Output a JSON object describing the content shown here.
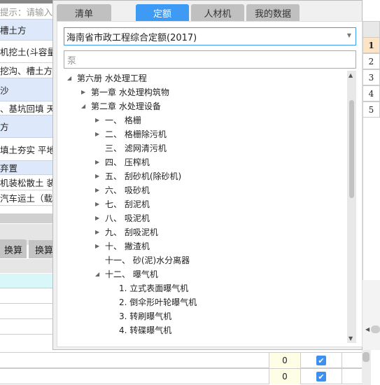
{
  "left_panel": {
    "hint": "提示：请输入子",
    "rows": [
      {
        "text": "槽土方",
        "highlight": true
      },
      {
        "text": "机挖土(斗容量(",
        "highlight": false
      },
      {
        "text": "挖沟、槽土方 -",
        "highlight": false
      },
      {
        "text": "沙",
        "highlight": true
      },
      {
        "text": "、基坑回填 天:",
        "highlight": false
      },
      {
        "text": "方",
        "highlight": true
      },
      {
        "text": "填土夯实 平地",
        "highlight": false
      },
      {
        "text": "弃置",
        "highlight": true
      },
      {
        "text": "机装松散土 装:",
        "highlight": false
      },
      {
        "text": "汽车运土（载重",
        "highlight": false
      }
    ],
    "tabs": [
      "换算",
      "换算"
    ]
  },
  "popup": {
    "tabs": [
      {
        "label": "清单",
        "active": false
      },
      {
        "label": "定额",
        "active": true
      },
      {
        "label": "人材机",
        "active": false
      },
      {
        "label": "我的数据",
        "active": false
      }
    ],
    "quota_select": {
      "value": "海南省市政工程综合定额(2017)"
    },
    "search": {
      "value": "泵"
    },
    "tree": [
      {
        "label": "第六册 水处理工程",
        "level": 0,
        "state": "expanded"
      },
      {
        "label": "第一章 水处理构筑物",
        "level": 1,
        "state": "collapsed"
      },
      {
        "label": "第二章 水处理设备",
        "level": 1,
        "state": "expanded"
      },
      {
        "label": "一、 格栅",
        "level": 2,
        "state": "collapsed"
      },
      {
        "label": "二、 格栅除污机",
        "level": 2,
        "state": "collapsed"
      },
      {
        "label": "三、 滤网清污机",
        "level": 2,
        "state": "leaf"
      },
      {
        "label": "四、 压榨机",
        "level": 2,
        "state": "collapsed"
      },
      {
        "label": "五、 刮砂机(除砂机)",
        "level": 2,
        "state": "collapsed"
      },
      {
        "label": "六、 吸砂机",
        "level": 2,
        "state": "collapsed"
      },
      {
        "label": "七、 刮泥机",
        "level": 2,
        "state": "collapsed"
      },
      {
        "label": "八、 吸泥机",
        "level": 2,
        "state": "collapsed"
      },
      {
        "label": "九、 刮吸泥机",
        "level": 2,
        "state": "collapsed"
      },
      {
        "label": "十、 撇渣机",
        "level": 2,
        "state": "collapsed"
      },
      {
        "label": "十一、 砂(泥)水分离器",
        "level": 2,
        "state": "leaf"
      },
      {
        "label": "十二、 曝气机",
        "level": 2,
        "state": "expanded"
      },
      {
        "label": "1. 立式表面曝气机",
        "level": 3,
        "state": "leaf"
      },
      {
        "label": "2. 倒伞形叶轮曝气机",
        "level": 3,
        "state": "leaf"
      },
      {
        "label": "3. 转刷曝气机",
        "level": 3,
        "state": "leaf"
      },
      {
        "label": "4. 转碟曝气机",
        "level": 3,
        "state": "leaf"
      }
    ]
  },
  "right_grid": {
    "row_numbers": [
      "1",
      "2",
      "3",
      "4",
      "5"
    ]
  },
  "bottom_rows": [
    {
      "value": "0",
      "checked": true
    },
    {
      "value": "0",
      "checked": true
    }
  ],
  "colors": {
    "accent": "#3d9bf5",
    "row_highlight": "#dde9fb",
    "selected_row": "#fde4c4",
    "value_cell": "#fefee6"
  }
}
